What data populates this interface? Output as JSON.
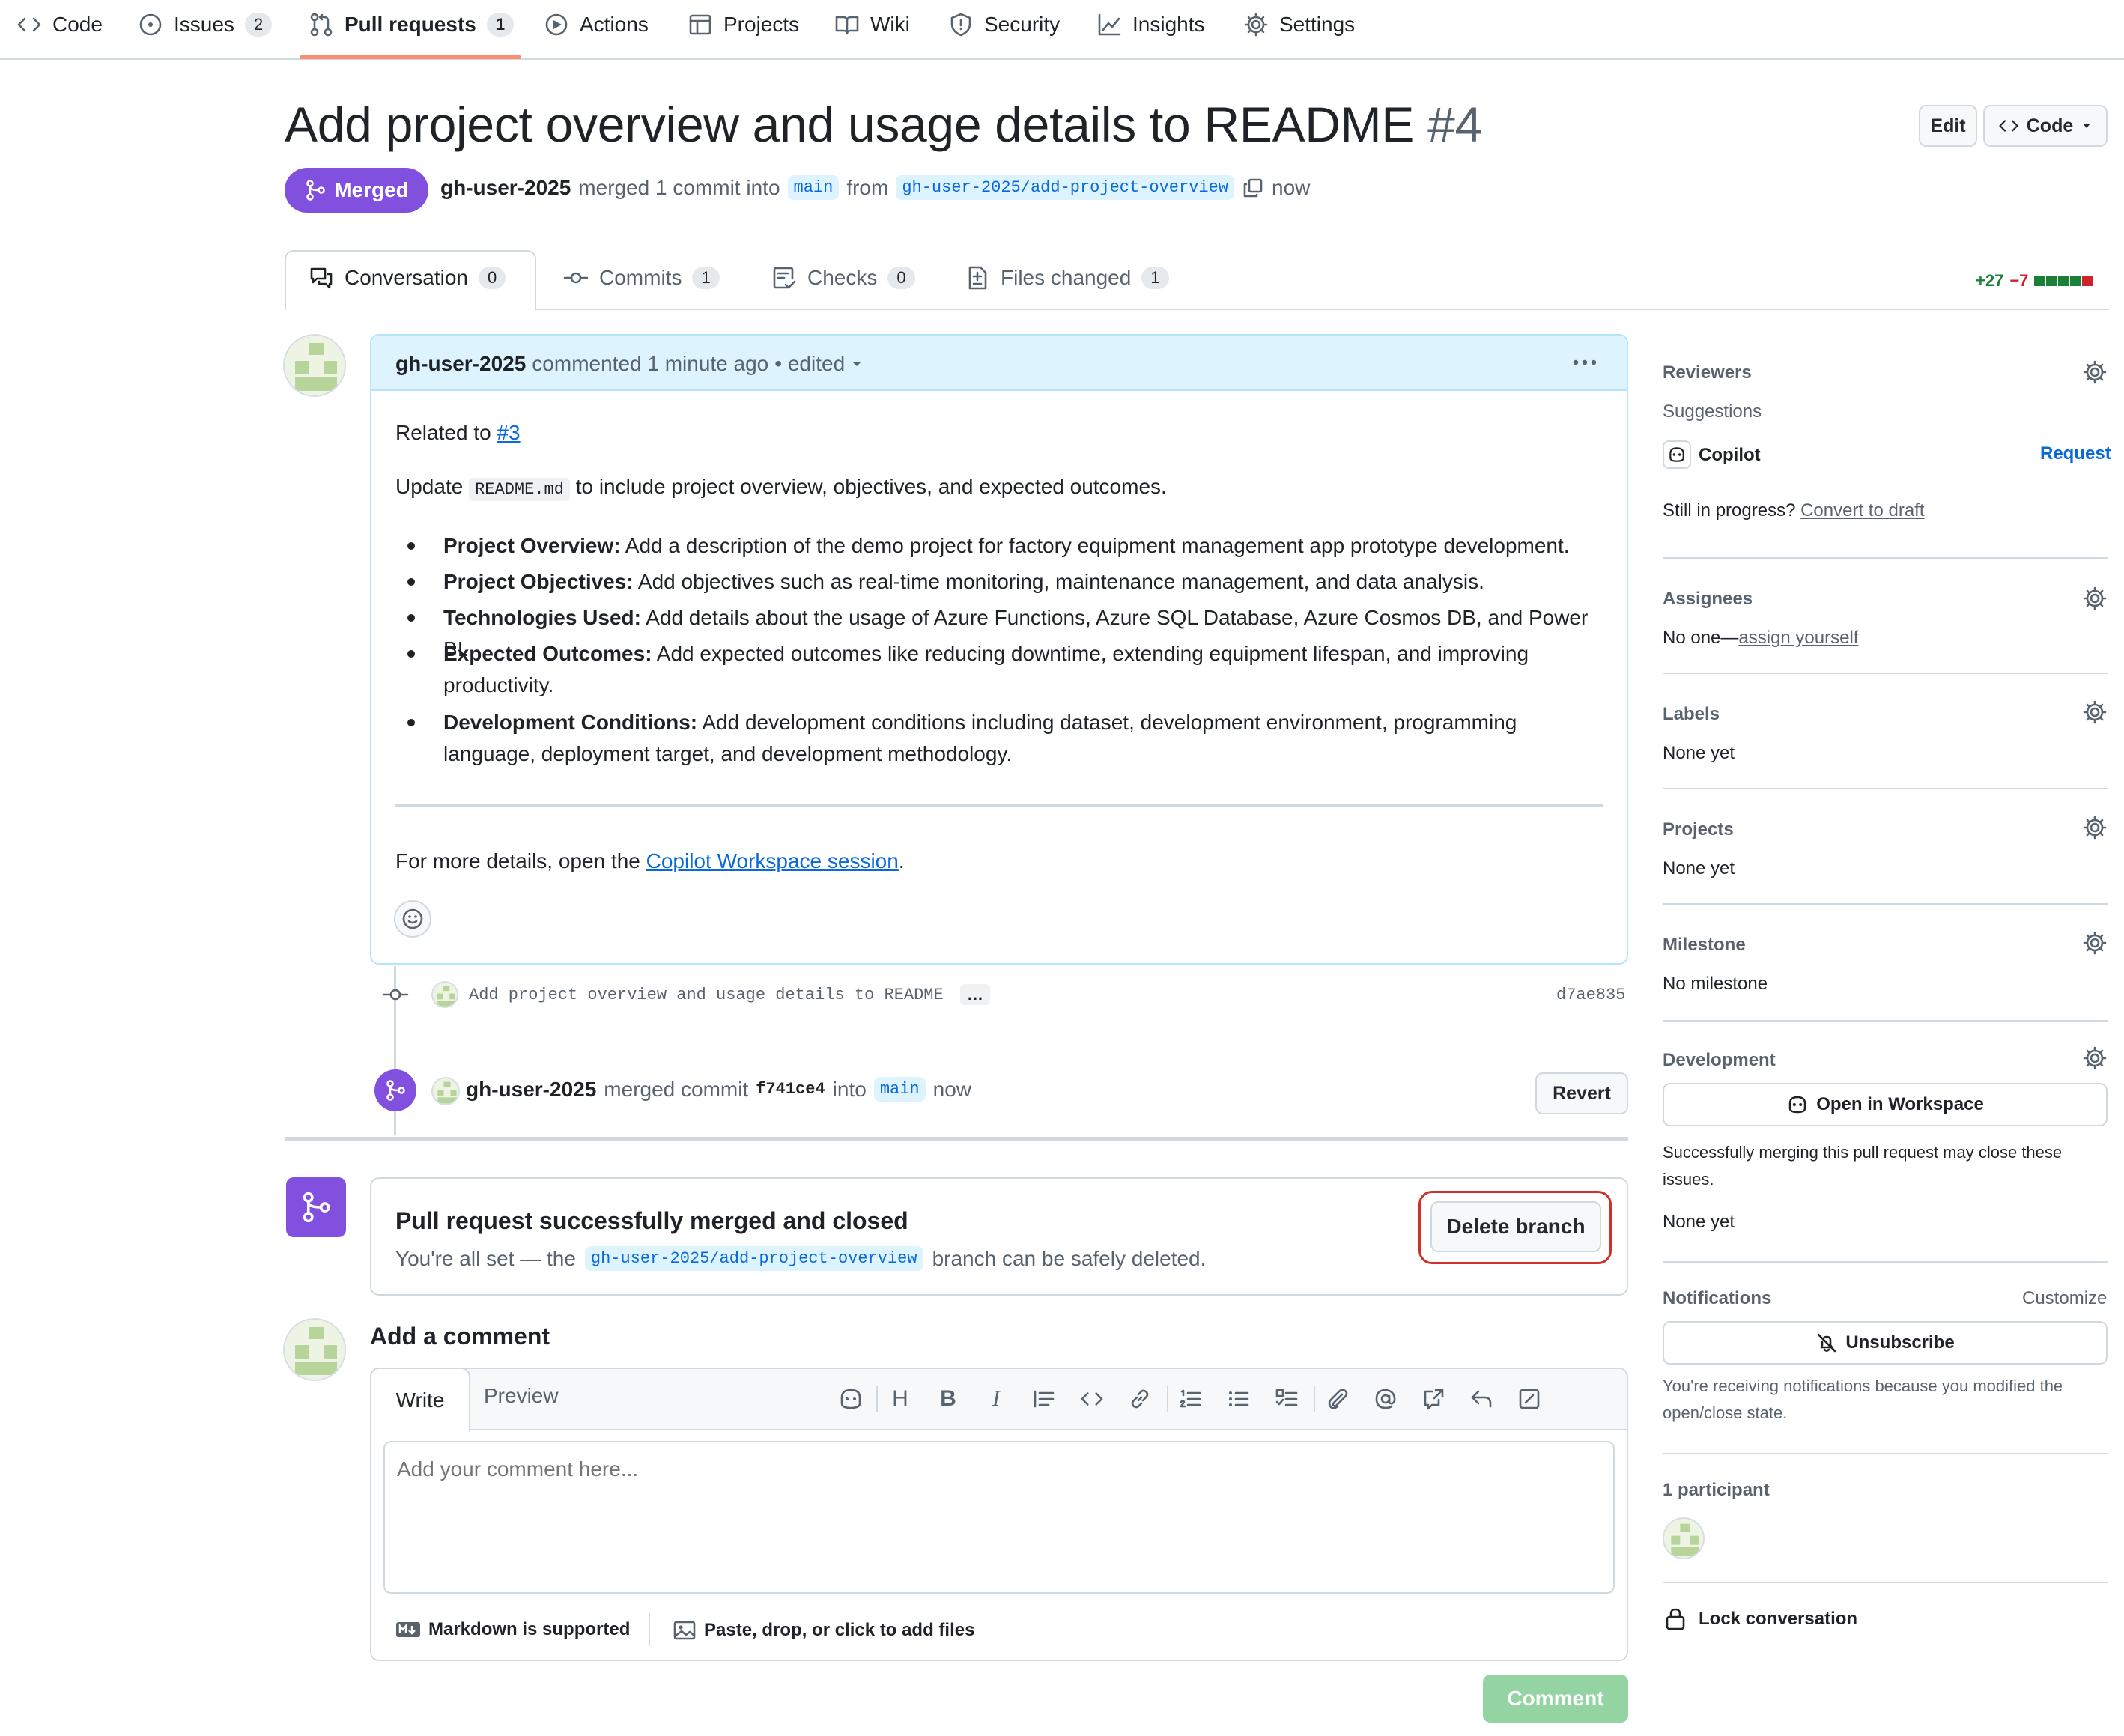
{
  "nav": {
    "items": [
      {
        "label": "Code",
        "icon": "code-icon"
      },
      {
        "label": "Issues",
        "icon": "issue-opened-icon",
        "count": "2"
      },
      {
        "label": "Pull requests",
        "icon": "git-pull-request-icon",
        "count": "1"
      },
      {
        "label": "Actions",
        "icon": "play-icon"
      },
      {
        "label": "Projects",
        "icon": "table-icon"
      },
      {
        "label": "Wiki",
        "icon": "book-icon"
      },
      {
        "label": "Security",
        "icon": "shield-icon"
      },
      {
        "label": "Insights",
        "icon": "graph-icon"
      },
      {
        "label": "Settings",
        "icon": "gear-icon"
      }
    ],
    "active": "Pull requests"
  },
  "pr": {
    "title": "Add project overview and usage details to README",
    "number": "#4",
    "status": "Merged",
    "author": "gh-user-2025",
    "merged_text": "merged 1 commit into",
    "base_branch": "main",
    "from_text": "from",
    "head_branch": "gh-user-2025/add-project-overview",
    "time": "now",
    "edit_label": "Edit",
    "code_label": "Code"
  },
  "tabs": [
    {
      "label": "Conversation",
      "count": "0",
      "icon": "comment-discussion-icon"
    },
    {
      "label": "Commits",
      "count": "1",
      "icon": "git-commit-icon"
    },
    {
      "label": "Checks",
      "count": "0",
      "icon": "checklist-icon"
    },
    {
      "label": "Files changed",
      "count": "1",
      "icon": "file-diff-icon"
    }
  ],
  "diffstat": {
    "additions": "+27",
    "deletions": "−7",
    "colors": {
      "add": "#1a7f37",
      "del": "#cf222e",
      "neutral": "#d1d9e0"
    }
  },
  "comment": {
    "author": "gh-user-2025",
    "meta": "commented 1 minute ago",
    "edited": "• edited",
    "related_prefix": "Related to",
    "related_link": "#3",
    "update_prefix": "Update",
    "update_file": "README.md",
    "update_suffix": "to include project overview, objectives, and expected outcomes.",
    "bullets": [
      {
        "bold": "Project Overview:",
        "text": " Add a description of the demo project for factory equipment management app prototype development."
      },
      {
        "bold": "Project Objectives:",
        "text": " Add objectives such as real-time monitoring, maintenance management, and data analysis."
      },
      {
        "bold": "Technologies Used:",
        "text": " Add details about the usage of Azure Functions, Azure SQL Database, Azure Cosmos DB, and Power BI."
      },
      {
        "bold": "Expected Outcomes:",
        "text": " Add expected outcomes like reducing downtime, extending equipment lifespan, and improving productivity."
      },
      {
        "bold": "Development Conditions:",
        "text": " Add development conditions including dataset, development environment, programming language, deployment target, and development methodology."
      }
    ],
    "more_prefix": "For more details, open the",
    "more_link": "Copilot Workspace session",
    "more_suffix": "."
  },
  "timeline": {
    "commit_message": "Add project overview and usage details to README",
    "commit_ellipsis": "…",
    "commit_sha": "d7ae835",
    "merge_author": "gh-user-2025",
    "merge_text": "merged commit",
    "merge_sha": "f741ce4",
    "into_text": "into",
    "merge_branch": "main",
    "merge_time": "now",
    "revert_label": "Revert"
  },
  "merged_panel": {
    "title": "Pull request successfully merged and closed",
    "desc_prefix": "You're all set — the",
    "branch": "gh-user-2025/add-project-overview",
    "desc_suffix": "branch can be safely deleted.",
    "delete_label": "Delete branch"
  },
  "new_comment": {
    "title": "Add a comment",
    "write_tab": "Write",
    "preview_tab": "Preview",
    "placeholder": "Add your comment here...",
    "markdown_note": "Markdown is supported",
    "files_note": "Paste, drop, or click to add files",
    "submit_label": "Comment"
  },
  "sidebar": {
    "reviewers": {
      "title": "Reviewers",
      "suggestions": "Suggestions",
      "suggested": "Copilot",
      "request": "Request",
      "draft_prefix": "Still in progress?",
      "draft_link": "Convert to draft"
    },
    "assignees": {
      "title": "Assignees",
      "prefix": "No one—",
      "link": "assign yourself"
    },
    "labels": {
      "title": "Labels",
      "value": "None yet"
    },
    "projects": {
      "title": "Projects",
      "value": "None yet"
    },
    "milestone": {
      "title": "Milestone",
      "value": "No milestone"
    },
    "development": {
      "title": "Development",
      "button": "Open in Workspace",
      "note": "Successfully merging this pull request may close these",
      "note2": "issues.",
      "value": "None yet"
    },
    "notifications": {
      "title": "Notifications",
      "customize": "Customize",
      "button": "Unsubscribe",
      "note": "You're receiving notifications because you modified the",
      "note2": "open/close state."
    },
    "participants": {
      "title": "1 participant"
    },
    "lock": "Lock conversation"
  }
}
